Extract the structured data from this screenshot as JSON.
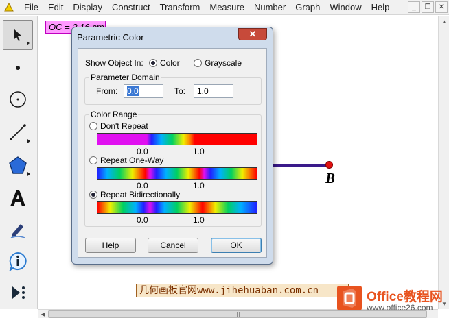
{
  "menubar": {
    "items": [
      "File",
      "Edit",
      "Display",
      "Construct",
      "Transform",
      "Measure",
      "Number",
      "Graph",
      "Window",
      "Help"
    ]
  },
  "canvas": {
    "measurement_label": "OC = 3.16 cm",
    "point_label": "B",
    "watermark": "几何画板官网www.jihehuaban.com.cn"
  },
  "logo": {
    "brand": "Office教程网",
    "url": "www.office26.com"
  },
  "dialog": {
    "title": "Parametric Color",
    "close": "✕",
    "show_object_in_label": "Show Object In:",
    "show_options": [
      {
        "label": "Color",
        "selected": true
      },
      {
        "label": "Grayscale",
        "selected": false
      }
    ],
    "parameter_domain": {
      "title": "Parameter Domain",
      "from_label": "From:",
      "from_value": "0.0",
      "to_label": "To:",
      "to_value": "1.0"
    },
    "color_range": {
      "title": "Color Range",
      "options": [
        {
          "label": "Don't Repeat",
          "selected": false,
          "tick_start": "0.0",
          "tick_end": "1.0"
        },
        {
          "label": "Repeat One-Way",
          "selected": false,
          "tick_start": "0.0",
          "tick_end": "1.0"
        },
        {
          "label": "Repeat Bidirectionally",
          "selected": true,
          "tick_start": "0.0",
          "tick_end": "1.0"
        }
      ]
    },
    "buttons": {
      "help": "Help",
      "cancel": "Cancel",
      "ok": "OK"
    }
  },
  "colors": {
    "measure_bg": "#ff99ff",
    "point": "#e01010",
    "segment": "#3a1a8a",
    "close_btn": "#c74a3a",
    "logo_orange": "#e8531f"
  }
}
